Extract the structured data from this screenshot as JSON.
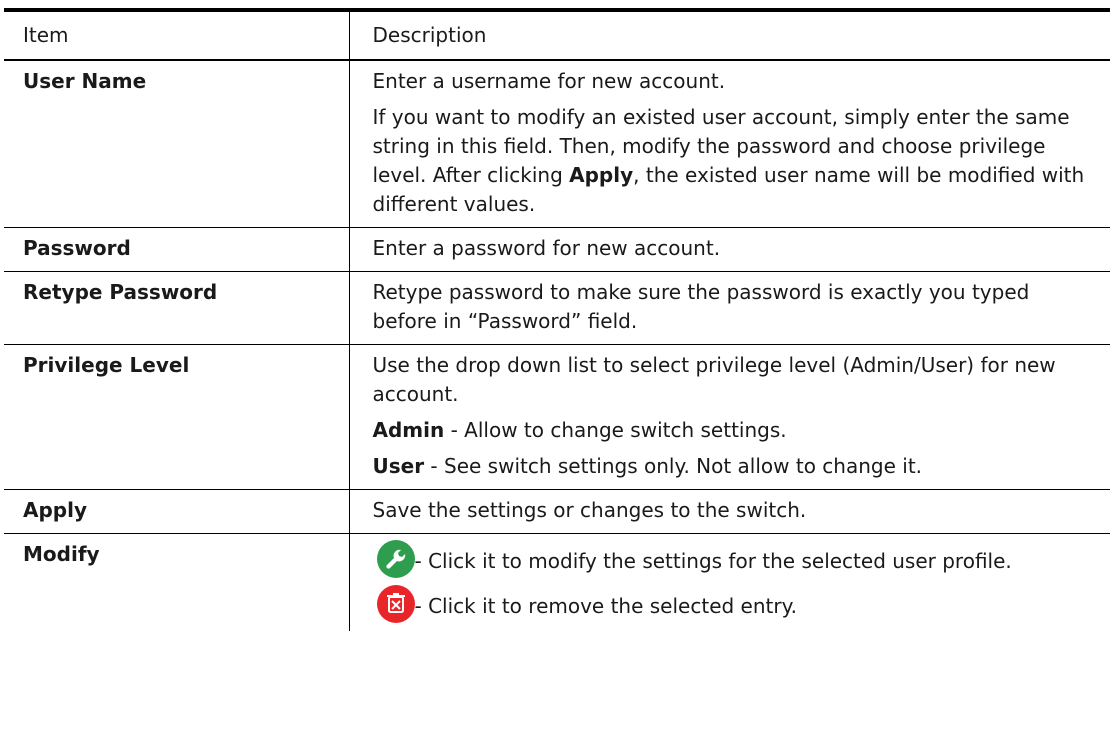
{
  "header": {
    "item": "Item",
    "description": "Description"
  },
  "rows": [
    {
      "item": "User Name",
      "p1": "Enter a username for new account.",
      "p2_a": "If you want to modify an existed user account, simply enter the same string in this field. Then, modify the password and choose privilege level. After clicking ",
      "p2_b": "Apply",
      "p2_c": ", the existed user name will be modified with different values."
    },
    {
      "item": "Password",
      "p1": "Enter a password for new account."
    },
    {
      "item": "Retype Password",
      "p1": "Retype password to make sure the password is exactly you typed before in “Password” field."
    },
    {
      "item": "Privilege Level",
      "p1": "Use the drop down list to select privilege level (Admin/User) for new account.",
      "p2_b": "Admin",
      "p2_c": " - Allow to change switch settings.",
      "p3_b": "User",
      "p3_c": " - See switch settings only. Not allow to change it."
    },
    {
      "item": "Apply",
      "p1": "Save the settings or changes to the switch."
    },
    {
      "item": "Modify",
      "p1": "- Click it to modify the settings for the selected user profile.",
      "p2": "- Click it to remove the selected entry.",
      "icon1": "wrench-icon",
      "icon1_color": "#2e9e4e",
      "icon2": "trash-icon",
      "icon2_color": "#e8262a"
    }
  ]
}
